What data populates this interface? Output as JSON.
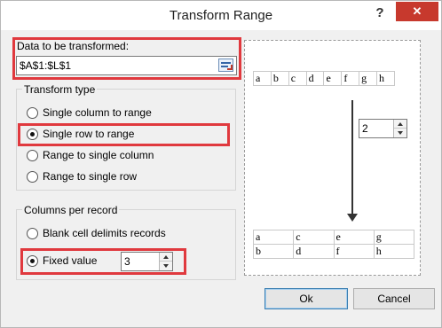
{
  "window": {
    "title": "Transform Range",
    "help_label": "?",
    "close_label": "✕"
  },
  "range": {
    "label": "Data to be transformed:",
    "value": "$A$1:$L$1",
    "icon": "range-select-icon"
  },
  "transform_type": {
    "title": "Transform type",
    "options": [
      {
        "label": "Single column to range",
        "checked": false
      },
      {
        "label": "Single row to range",
        "checked": true
      },
      {
        "label": "Range to single column",
        "checked": false
      },
      {
        "label": "Range to single row",
        "checked": false
      }
    ]
  },
  "columns_per_record": {
    "title": "Columns per record",
    "blank_cell_label": "Blank cell delimits records",
    "fixed_value_label": "Fixed value",
    "fixed_value": "3"
  },
  "preview": {
    "top_row": [
      "a",
      "b",
      "c",
      "d",
      "e",
      "f",
      "g",
      "h"
    ],
    "spin_value": "2",
    "result_rows": [
      [
        "a",
        "c",
        "e",
        "g"
      ],
      [
        "b",
        "d",
        "f",
        "h"
      ]
    ]
  },
  "buttons": {
    "ok": "Ok",
    "cancel": "Cancel"
  },
  "colors": {
    "highlight_border": "#e0393e",
    "close_button": "#c7392d"
  }
}
